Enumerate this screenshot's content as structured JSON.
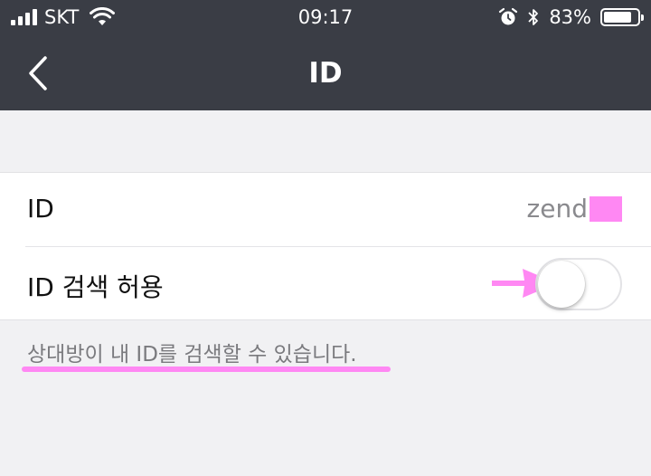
{
  "status_bar": {
    "carrier": "SKT",
    "time": "09:17",
    "battery_text": "83%",
    "battery_level": 0.83,
    "icons": [
      "signal-icon",
      "wifi-icon",
      "alarm-icon",
      "bluetooth-icon",
      "battery-icon"
    ]
  },
  "nav": {
    "title": "ID",
    "back_icon": "chevron-left-icon"
  },
  "settings": {
    "id_row": {
      "label": "ID",
      "value": "zend"
    },
    "search_row": {
      "label": "ID 검색 허용",
      "toggle_on": false
    }
  },
  "description": "상대방이 내 ID를 검색할 수 있습니다.",
  "colors": {
    "header_bg": "#3a3d45",
    "page_bg": "#f1f1f3",
    "highlight": "#ff88f3"
  }
}
